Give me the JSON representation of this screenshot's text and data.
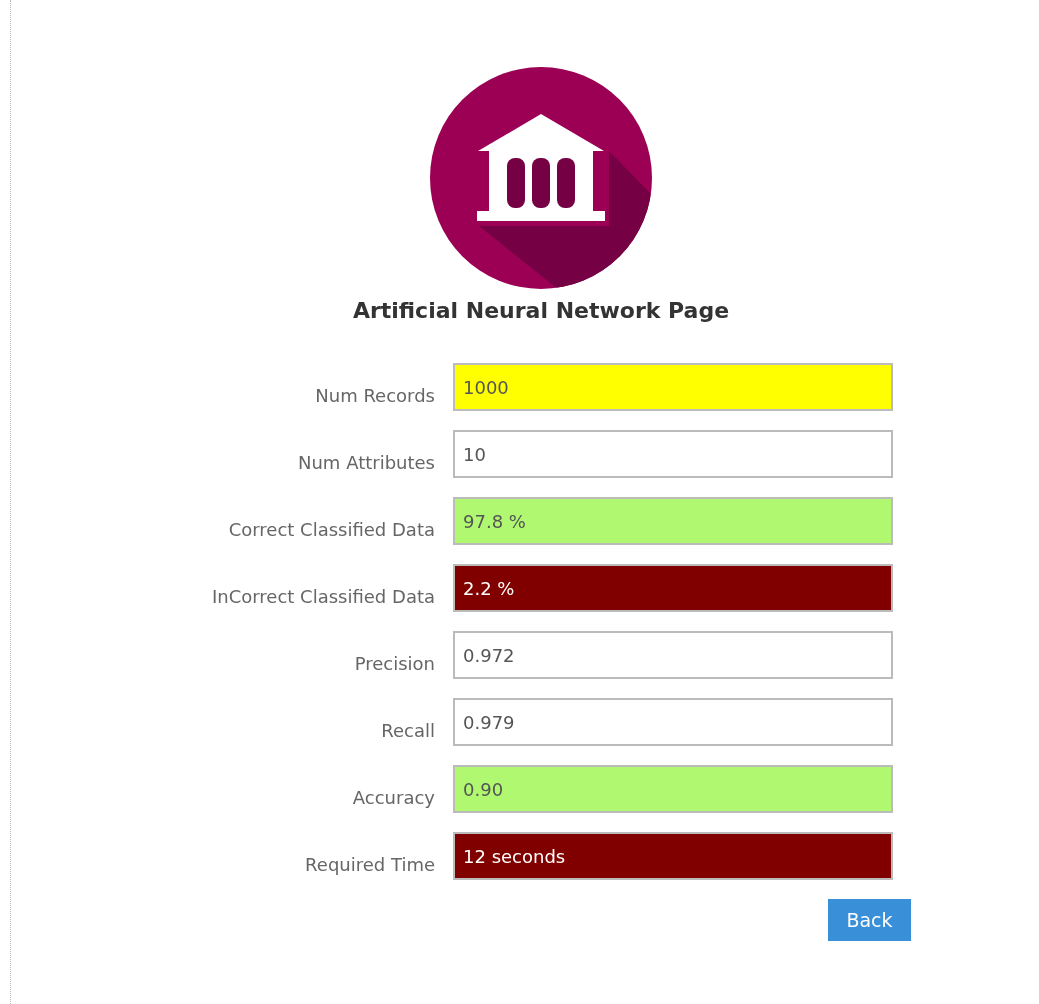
{
  "title": "Artificial Neural Network Page",
  "fields": [
    {
      "label": "Num Records",
      "value": "1000",
      "color": "#ffff00"
    },
    {
      "label": "Num Attributes",
      "value": "10",
      "color": "#ffffff"
    },
    {
      "label": "Correct Classified Data",
      "value": "97.8 %",
      "color": "#b0f870"
    },
    {
      "label": "InCorrect Classified Data",
      "value": "2.2 %",
      "color": "#800000"
    },
    {
      "label": "Precision",
      "value": "0.972",
      "color": "#ffffff"
    },
    {
      "label": "Recall",
      "value": "0.979",
      "color": "#ffffff"
    },
    {
      "label": "Accuracy",
      "value": "0.90",
      "color": "#b0f870"
    },
    {
      "label": "Required Time",
      "value": "12 seconds",
      "color": "#800000"
    }
  ],
  "buttons": [
    "Back"
  ]
}
